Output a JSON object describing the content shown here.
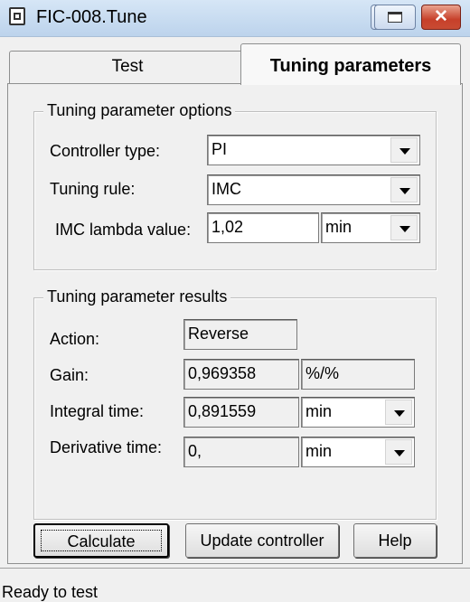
{
  "window": {
    "title": "FIC-008.Tune"
  },
  "tabs": {
    "test": "Test",
    "tuning": "Tuning parameters"
  },
  "options": {
    "legend": "Tuning parameter options",
    "controller_type_label": "Controller type:",
    "controller_type_value": "PI",
    "tuning_rule_label": "Tuning rule:",
    "tuning_rule_value": "IMC",
    "lambda_label": "IMC lambda value:",
    "lambda_value": "1,02",
    "lambda_unit": "min"
  },
  "results": {
    "legend": "Tuning parameter results",
    "action_label": "Action:",
    "action_value": "Reverse",
    "gain_label": "Gain:",
    "gain_value": "0,969358",
    "gain_unit": "%/%",
    "integral_label": "Integral time:",
    "integral_value": "0,891559",
    "integral_unit": "min",
    "derivative_label": "Derivative time:",
    "derivative_value": "0,",
    "derivative_unit": "min"
  },
  "buttons": {
    "calculate": "Calculate",
    "update": "Update controller",
    "help": "Help"
  },
  "status": {
    "text": "Ready to test"
  },
  "colors": {
    "titlebar": "#c9dcf1",
    "close_button": "#c7402a",
    "background": "#f0f0f0"
  }
}
